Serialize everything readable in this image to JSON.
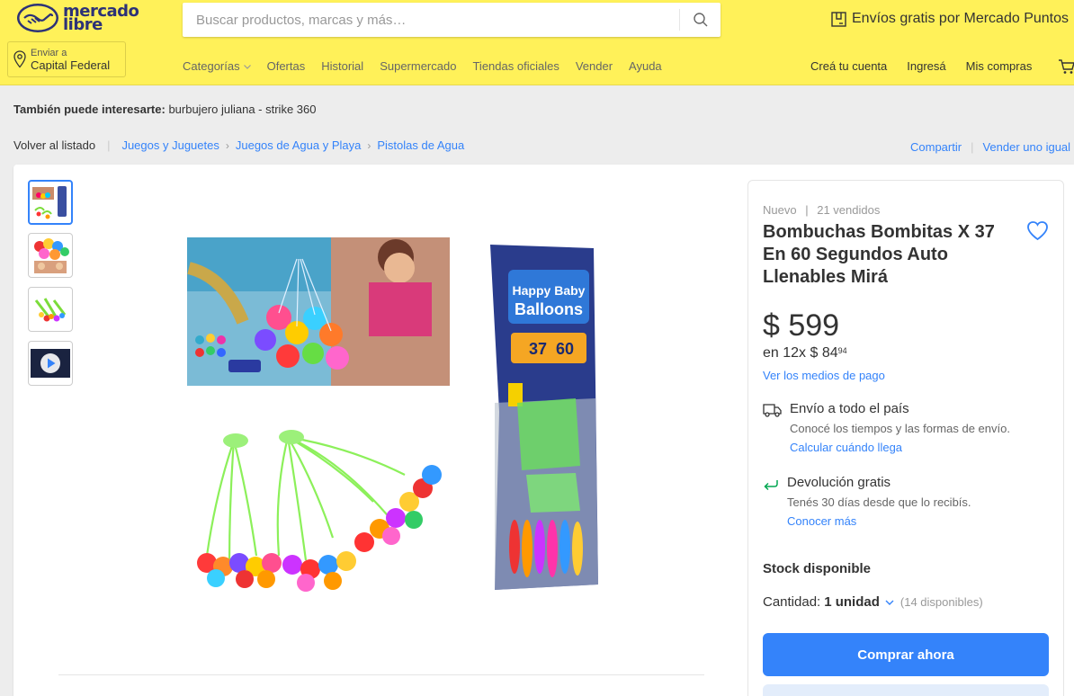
{
  "header": {
    "logo_line1": "mercado",
    "logo_line2": "libre",
    "search_placeholder": "Buscar productos, marcas y más…",
    "promo": "Envíos gratis por Mercado Puntos",
    "location_label": "Enviar a",
    "location_value": "Capital Federal",
    "nav": [
      "Categorías",
      "Ofertas",
      "Historial",
      "Supermercado",
      "Tiendas oficiales",
      "Vender",
      "Ayuda"
    ],
    "account": [
      "Creá tu cuenta",
      "Ingresá",
      "Mis compras"
    ]
  },
  "suggestion": {
    "label": "También puede interesarte:",
    "value": "burbujero juliana - strike 360"
  },
  "breadcrumb": {
    "back": "Volver al listado",
    "items": [
      "Juegos y Juguetes",
      "Juegos de Agua y Playa",
      "Pistolas de Agua"
    ]
  },
  "actions": {
    "share": "Compartir",
    "sell": "Vender uno igual"
  },
  "product": {
    "condition": "Nuevo",
    "sold": "21 vendidos",
    "title": "Bombuchas Bombitas X 37 En 60 Segundos Auto Llenables Mirá",
    "price": "$ 599",
    "installments_prefix": "en 12x $ 84",
    "installments_cents": "94",
    "payment_link": "Ver los medios de pago",
    "package_brand_line1": "Happy Baby",
    "package_brand_line2": "Balloons",
    "package_count": "37",
    "package_seconds": "60"
  },
  "shipping": {
    "title": "Envío a todo el país",
    "subtitle": "Conocé los tiempos y las formas de envío.",
    "link": "Calcular cuándo llega"
  },
  "returns": {
    "title": "Devolución gratis",
    "subtitle": "Tenés 30 días desde que lo recibís.",
    "link": "Conocer más"
  },
  "stock": {
    "label": "Stock disponible",
    "qty_label": "Cantidad:",
    "qty_value": "1 unidad",
    "available": "(14 disponibles)"
  },
  "buttons": {
    "buy_now": "Comprar ahora"
  },
  "colors": {
    "header_bg": "#fff159",
    "accent": "#3483fa",
    "green": "#00a650"
  }
}
